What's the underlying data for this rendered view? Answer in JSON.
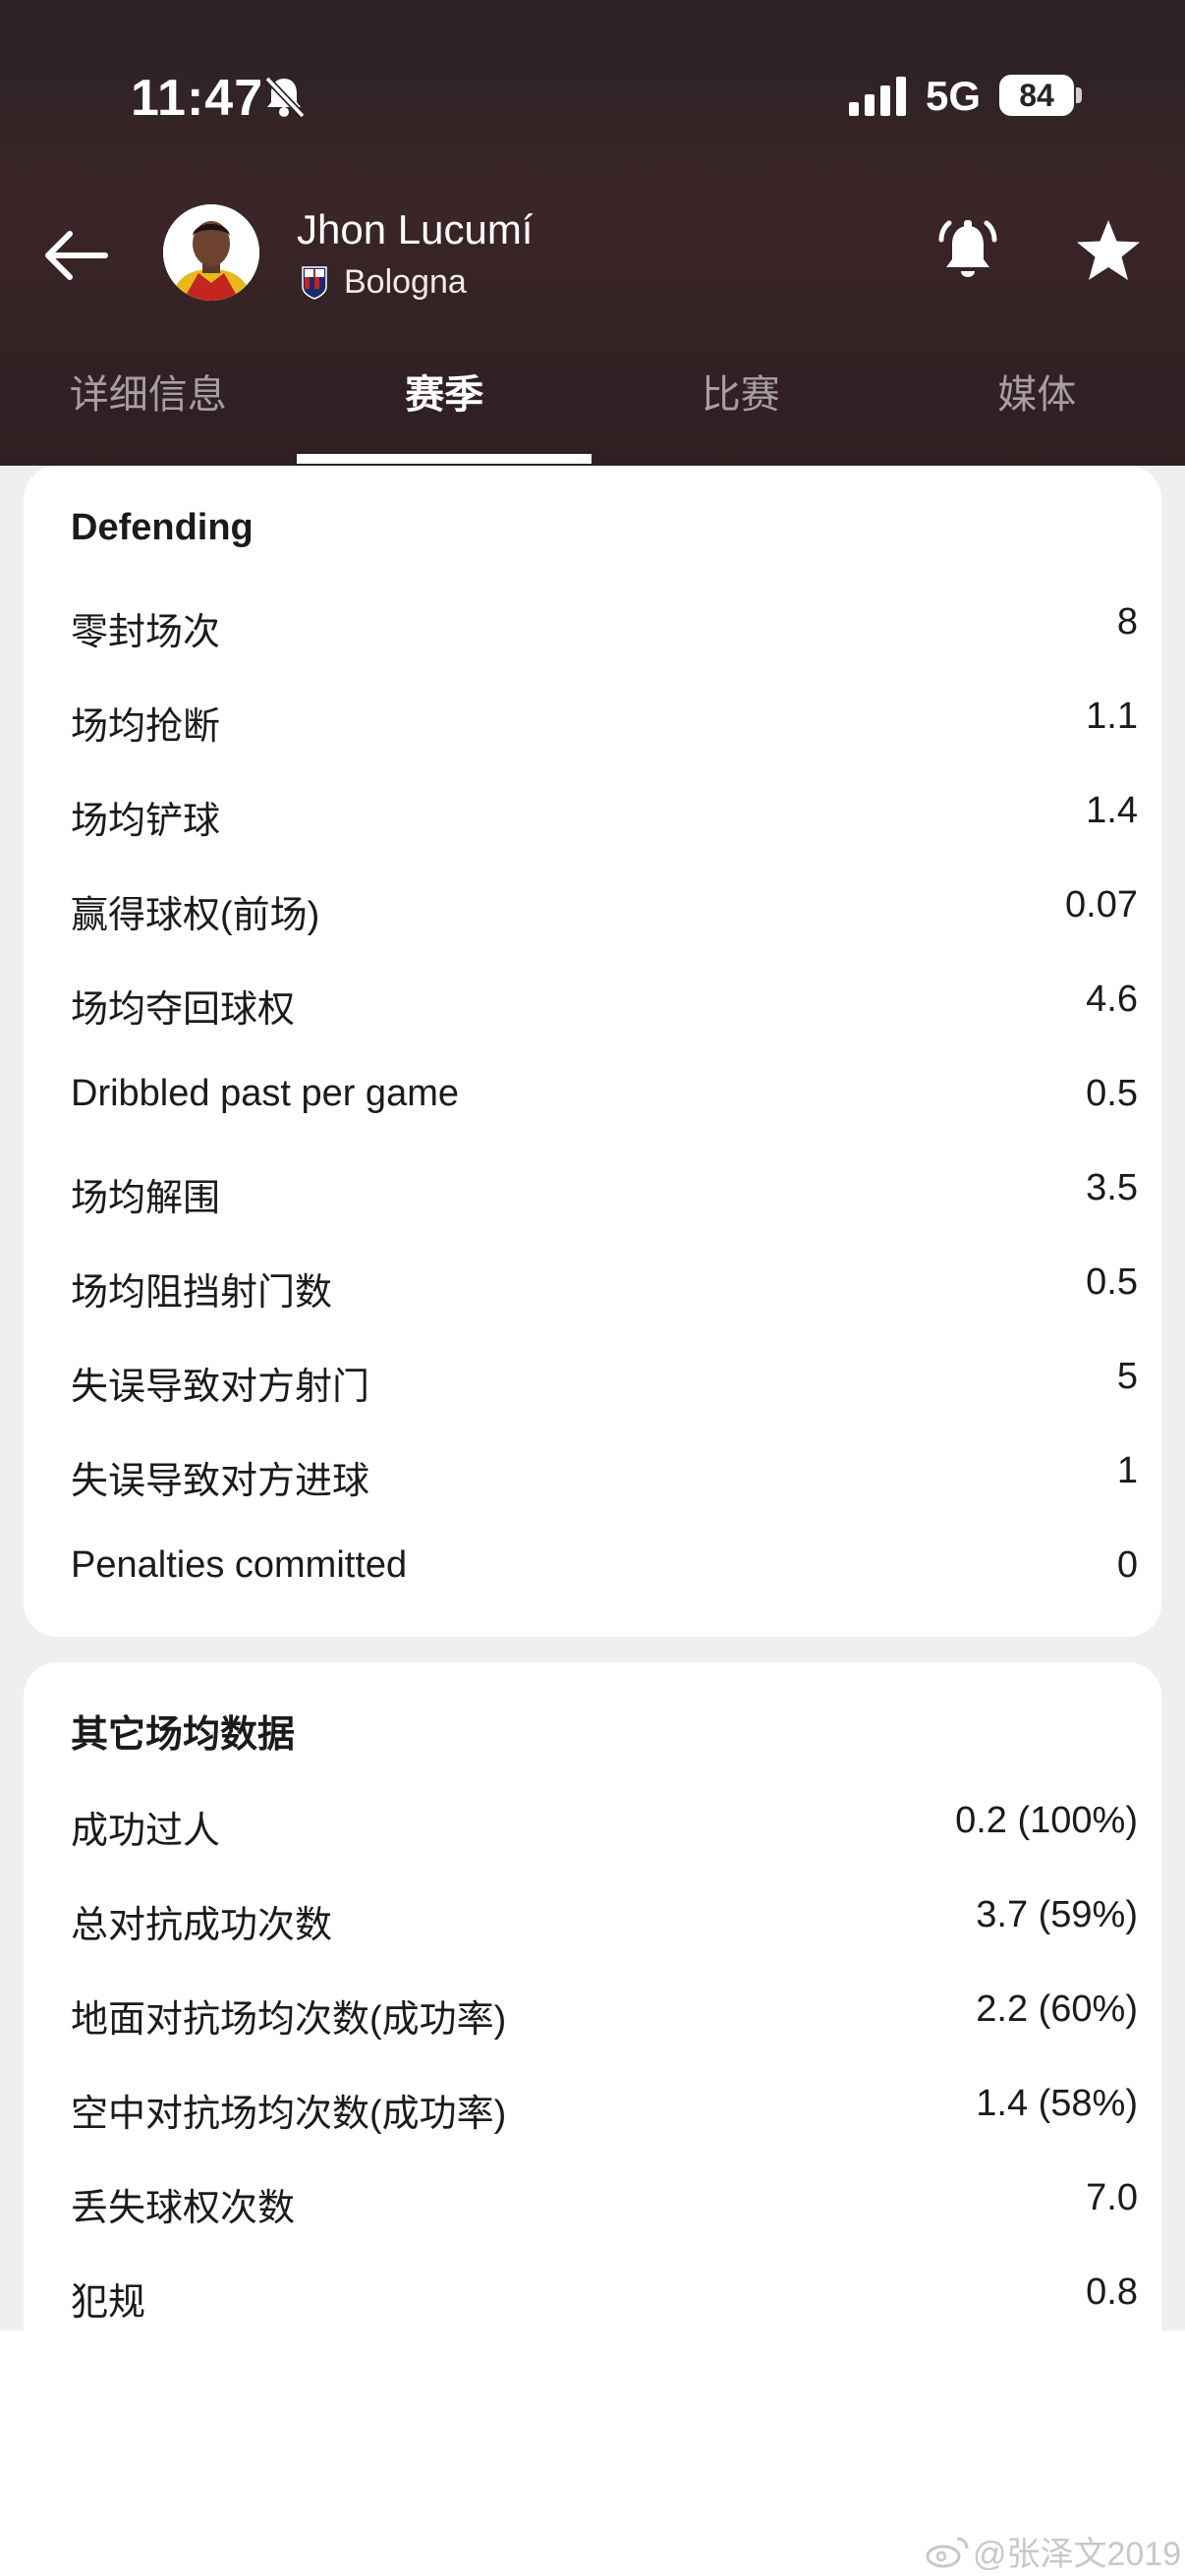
{
  "status_bar": {
    "time": "11:47",
    "network": "5G",
    "battery": "84"
  },
  "header": {
    "player_name": "Jhon Lucumí",
    "team_name": "Bologna"
  },
  "tabs": [
    {
      "label": "详细信息",
      "active": false
    },
    {
      "label": "赛季",
      "active": true
    },
    {
      "label": "比赛",
      "active": false
    },
    {
      "label": "媒体",
      "active": false
    }
  ],
  "defending": {
    "title": "Defending",
    "rows": [
      {
        "label": "零封场次",
        "value": "8"
      },
      {
        "label": "场均抢断",
        "value": "1.1"
      },
      {
        "label": "场均铲球",
        "value": "1.4"
      },
      {
        "label": "赢得球权(前场)",
        "value": "0.07"
      },
      {
        "label": "场均夺回球权",
        "value": "4.6"
      },
      {
        "label": "Dribbled past per game",
        "value": "0.5"
      },
      {
        "label": "场均解围",
        "value": "3.5"
      },
      {
        "label": "场均阻挡射门数",
        "value": "0.5"
      },
      {
        "label": "失误导致对方射门",
        "value": "5"
      },
      {
        "label": "失误导致对方进球",
        "value": "1"
      },
      {
        "label": "Penalties committed",
        "value": "0"
      }
    ]
  },
  "other": {
    "title": "其它场均数据",
    "rows": [
      {
        "label": "成功过人",
        "value": "0.2 (100%)"
      },
      {
        "label": "总对抗成功次数",
        "value": "3.7 (59%)"
      },
      {
        "label": "地面对抗场均次数(成功率)",
        "value": "2.2 (60%)"
      },
      {
        "label": "空中对抗场均次数(成功率)",
        "value": "1.4 (58%)"
      },
      {
        "label": "丢失球权次数",
        "value": "7.0"
      },
      {
        "label": "犯规",
        "value": "0.8"
      }
    ]
  },
  "watermark": "@张泽文2019",
  "colors": {
    "header_bg": "#2e1f22",
    "page_bg": "#f0efef",
    "card_bg": "#ffffff",
    "active_tab": "#ffffff",
    "inactive_tab": "#a79fa1"
  }
}
